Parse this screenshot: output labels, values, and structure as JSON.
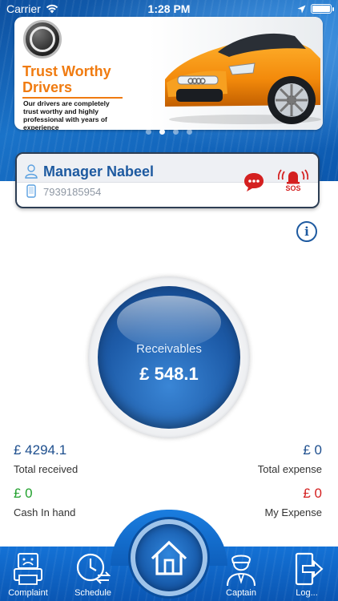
{
  "status_bar": {
    "carrier": "Carrier",
    "time": "1:28 PM",
    "battery_percent": 100
  },
  "banner": {
    "title": "Trust Worthy Drivers",
    "subtitle": "Our drivers are completely trust worthy and highly professional with years of experience",
    "slide_count": 4,
    "active_slide": 1
  },
  "profile": {
    "name": "Manager Nabeel",
    "phone": "7939185954",
    "sos_label": "SOS"
  },
  "receivables": {
    "label": "Receivables",
    "value": "£ 548.1"
  },
  "stats": {
    "total_received": {
      "value": "£ 4294.1",
      "label": "Total received"
    },
    "total_expense": {
      "value": "£ 0",
      "label": "Total expense"
    },
    "cash_in_hand": {
      "value": "£ 0",
      "label": "Cash In hand"
    },
    "my_expense": {
      "value": "£ 0",
      "label": "My Expense"
    }
  },
  "tabs": {
    "complaint": "Complaint",
    "schedule": "Schedule",
    "captain": "Captain",
    "logout": "Log..."
  },
  "colors": {
    "brand_blue": "#1e5aa0",
    "accent_orange": "#f07b10",
    "positive_green": "#22a12e",
    "alert_red": "#d42020"
  }
}
